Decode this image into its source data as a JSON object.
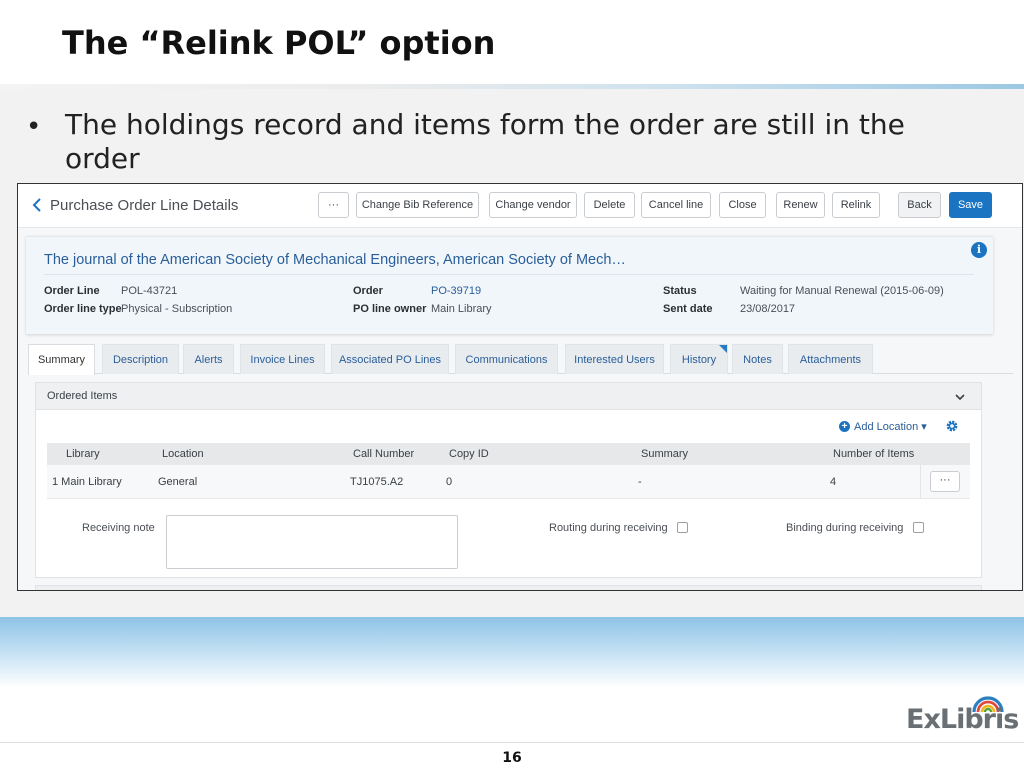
{
  "slide": {
    "title": "The “Relink POL” option",
    "bullet": "The holdings record and items form the order are still in the order",
    "page_number": "16",
    "logo_text": "ExLibris"
  },
  "header": {
    "title": "Purchase Order Line Details",
    "buttons": {
      "more": "···",
      "change_bib": "Change Bib Reference",
      "change_vendor": "Change vendor",
      "delete": "Delete",
      "cancel_line": "Cancel line",
      "close": "Close",
      "renew": "Renew",
      "relink": "Relink",
      "back": "Back",
      "save": "Save"
    }
  },
  "summary": {
    "title": "The journal of the American Society of Mechanical Engineers, American Society of Mech…",
    "info_glyph": "i",
    "fields": {
      "order_line_label": "Order Line",
      "order_line_value": "POL-43721",
      "order_line_type_label": "Order line type",
      "order_line_type_value": "Physical - Subscription",
      "order_label": "Order",
      "order_value": "PO-39719",
      "po_owner_label": "PO line owner",
      "po_owner_value": "Main Library",
      "status_label": "Status",
      "status_value": "Waiting for Manual Renewal (2015-06-09)",
      "sent_date_label": "Sent date",
      "sent_date_value": "23/08/2017"
    }
  },
  "tabs": [
    {
      "label": "Summary",
      "active": true
    },
    {
      "label": "Description"
    },
    {
      "label": "Alerts"
    },
    {
      "label": "Invoice Lines"
    },
    {
      "label": "Associated PO Lines"
    },
    {
      "label": "Communications"
    },
    {
      "label": "Interested Users"
    },
    {
      "label": "History",
      "flag": true
    },
    {
      "label": "Notes"
    },
    {
      "label": "Attachments"
    }
  ],
  "ordered_items": {
    "title": "Ordered Items",
    "add_location": "Add Location ▾",
    "columns": {
      "library": "Library",
      "location": "Location",
      "call_number": "Call Number",
      "copy_id": "Copy ID",
      "summary": "Summary",
      "number_of_items": "Number of Items"
    },
    "rows": [
      {
        "library": "1 Main Library",
        "location": "General",
        "call_number": "TJ1075.A2",
        "copy_id": "0",
        "summary": "-",
        "number_of_items": "4",
        "more": "···"
      }
    ],
    "receiving_note_label": "Receiving note",
    "receiving_note_value": "",
    "routing_label": "Routing during receiving",
    "routing_checked": false,
    "binding_label": "Binding during receiving",
    "binding_checked": false
  },
  "colors": {
    "accent": "#1b74c2",
    "link": "#2a5e99"
  }
}
